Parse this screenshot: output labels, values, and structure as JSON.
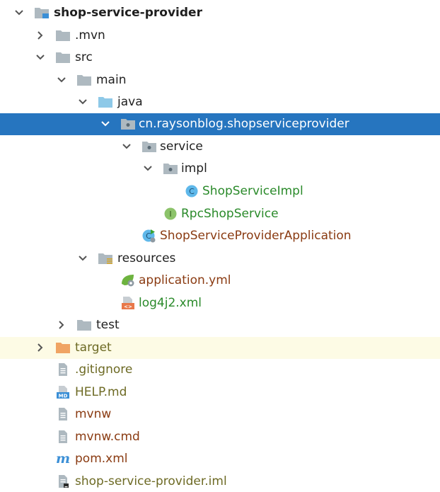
{
  "tree": {
    "root": {
      "label": "shop-service-provider"
    },
    "mvn": {
      "label": ".mvn"
    },
    "src": {
      "label": "src"
    },
    "main": {
      "label": "main"
    },
    "java": {
      "label": "java"
    },
    "package": {
      "label": "cn.raysonblog.shopserviceprovider"
    },
    "service": {
      "label": "service"
    },
    "impl": {
      "label": "impl"
    },
    "shop_service_impl": {
      "label": "ShopServiceImpl",
      "glyph": "C"
    },
    "rpc_shop_service": {
      "label": "RpcShopService",
      "glyph": "I"
    },
    "application_class": {
      "label": "ShopServiceProviderApplication",
      "glyph": "C"
    },
    "resources": {
      "label": "resources"
    },
    "application_yml": {
      "label": "application.yml"
    },
    "log4j2_xml": {
      "label": "log4j2.xml",
      "glyph": "<>"
    },
    "test": {
      "label": "test"
    },
    "target": {
      "label": "target"
    },
    "gitignore": {
      "label": ".gitignore"
    },
    "help_md": {
      "label": "HELP.md",
      "glyph": "MD"
    },
    "mvnw": {
      "label": "mvnw"
    },
    "mvnw_cmd": {
      "label": "mvnw.cmd"
    },
    "pom_xml": {
      "label": "pom.xml",
      "glyph": "m"
    },
    "iml": {
      "label": "shop-service-provider.iml"
    }
  },
  "colors": {
    "selection": "#2675bf",
    "highlight_row": "#fdfbe5",
    "folder_gray": "#aeb9c0",
    "source_folder_blue": "#8ec9e8",
    "excluded_folder_orange": "#f0a463",
    "class_icon": "#5fb8ea",
    "interface_icon": "#8cc36a",
    "label_green": "#2a8a2a",
    "label_brown": "#8a3b12",
    "label_olive": "#6d6a24"
  }
}
